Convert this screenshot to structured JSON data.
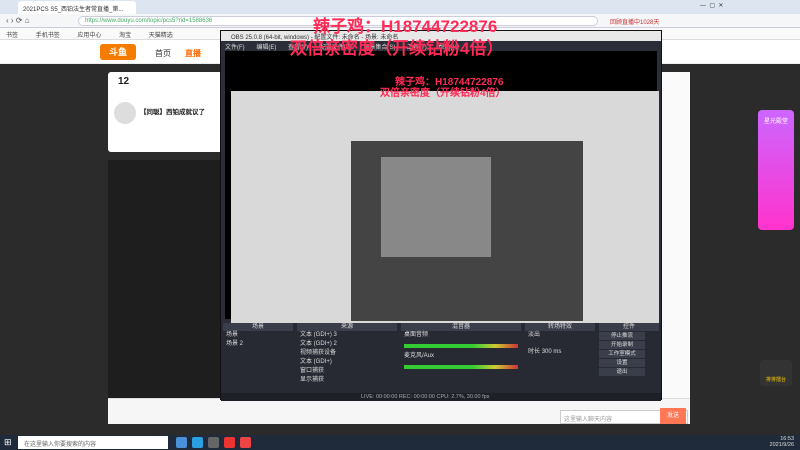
{
  "browser": {
    "tab_title": "2021PCS S5_西铂法生者常直播_第...",
    "url": "https://www.douyu.com/topic/pcs5?rid=1588636",
    "bookmarks": [
      "书签",
      "手机书签",
      "应用中心",
      "淘宝",
      "天猫精选"
    ],
    "top_right": "回顾直播中1028天"
  },
  "douyu": {
    "nav": [
      "首页",
      "直播"
    ],
    "room_number": "12",
    "streamer_title": "【同聪】西铂成就议了",
    "send_label": "发送",
    "chat_placeholder": "这里输入聊天内容",
    "promo_title": "星光殿堂",
    "promo_badge": "排排擂台"
  },
  "overlay": {
    "line1": "辣子鸡：H18744722876",
    "line2": "双倍亲密度（开续钻粉4倍）"
  },
  "obs": {
    "title": "OBS 25.0.8 (64-bit, windows) - 配置文件: 未命名 - 场景: 未命名",
    "menu": [
      "文件(F)",
      "编辑(E)",
      "查看(V)",
      "配置文件(P)",
      "场景集合(S)",
      "工具(T)",
      "帮助(H)"
    ],
    "panels": {
      "scenes": "场景",
      "sources": "来源",
      "mixer": "混音器",
      "transition": "转场特效",
      "controls": "控件"
    },
    "scenes": [
      "场景",
      "场景 2"
    ],
    "sources": [
      "文本 (GDI+) 3",
      "文本 (GDI+) 2",
      "视频捕获设备",
      "文本 (GDI+)",
      "窗口捕获",
      "显示捕获"
    ],
    "mixer_tracks": [
      "桌面音频",
      "麦克风/Aux"
    ],
    "transition_value": "淡出",
    "duration_label": "时长",
    "duration_value": "300 ms",
    "controls": [
      "停止推流",
      "开始录制",
      "工作室模式",
      "设置",
      "退出"
    ],
    "status": "LIVE: 00:00:00   REC: 00:00:00   CPU: 2.7%, 30.00 fps"
  },
  "taskbar": {
    "search_placeholder": "在这里输入你要搜索的内容",
    "time": "16:53",
    "date": "2021/9/26"
  }
}
